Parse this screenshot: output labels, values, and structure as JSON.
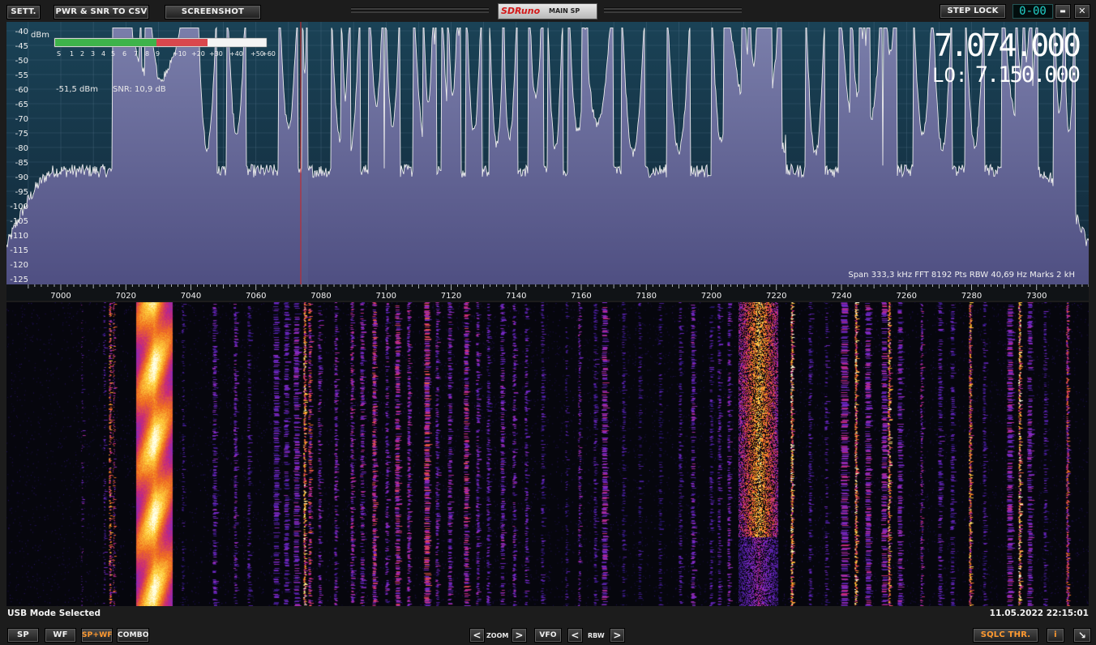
{
  "topbar": {
    "sett_label": "SETT.",
    "csv_label": "PWR & SNR TO CSV",
    "screenshot_label": "SCREENSHOT",
    "logo_brand": "SDRuno",
    "logo_panel": "MAIN SP",
    "step_lock_label": "STEP LOCK",
    "counter_value": "0-00",
    "minimize_symbol": "▬",
    "close_symbol": "✕"
  },
  "spectrum": {
    "unit_label": "dBm",
    "y_ticks": [
      "-40",
      "-45",
      "-50",
      "-55",
      "-60",
      "-65",
      "-70",
      "-75",
      "-80",
      "-85",
      "-90",
      "-95",
      "-100",
      "-105",
      "-110",
      "-115",
      "-120",
      "-125"
    ],
    "x_ticks": [
      "7000",
      "7020",
      "7040",
      "7060",
      "7080",
      "7100",
      "7120",
      "7140",
      "7160",
      "7180",
      "7200",
      "7220",
      "7240",
      "7260",
      "7280",
      "7300"
    ],
    "smeter_labels": [
      "S",
      "1",
      "2",
      "3",
      "4",
      "5",
      "6",
      "7",
      "8",
      "9",
      "+10",
      "+20",
      "+30",
      "+40",
      "+50",
      "+60"
    ],
    "power_text": "-51,5 dBm",
    "snr_text": "SNR: 10,9 dB",
    "vfo_frequency": "7.074.000",
    "lo_label": "LO:",
    "lo_frequency": "7.150.000",
    "info_text": "Span 333,3 kHz   FFT 8192 Pts   RBW 40,69 Hz   Marks 2 kH",
    "colors": {
      "background": "#173b4f",
      "fill": "#6b6f9e",
      "trace": "#ececec",
      "marker": "#d02020",
      "grid": "#4f6f86"
    }
  },
  "status": {
    "mode_text": "USB Mode Selected",
    "datetime_text": "11.05.2022 22:15:01"
  },
  "bottombar": {
    "sp_label": "SP",
    "wf_label": "WF",
    "spwf_label": "SP+WF",
    "combo_label": "COMBO",
    "zoom_label": "ZOOM",
    "vfo_label": "VFO",
    "rbw_label": "RBW",
    "left_arrow": "<",
    "right_arrow": ">",
    "sqlc_label": "SQLC THR.",
    "info_label": "i",
    "resize_symbol": "↘"
  }
}
